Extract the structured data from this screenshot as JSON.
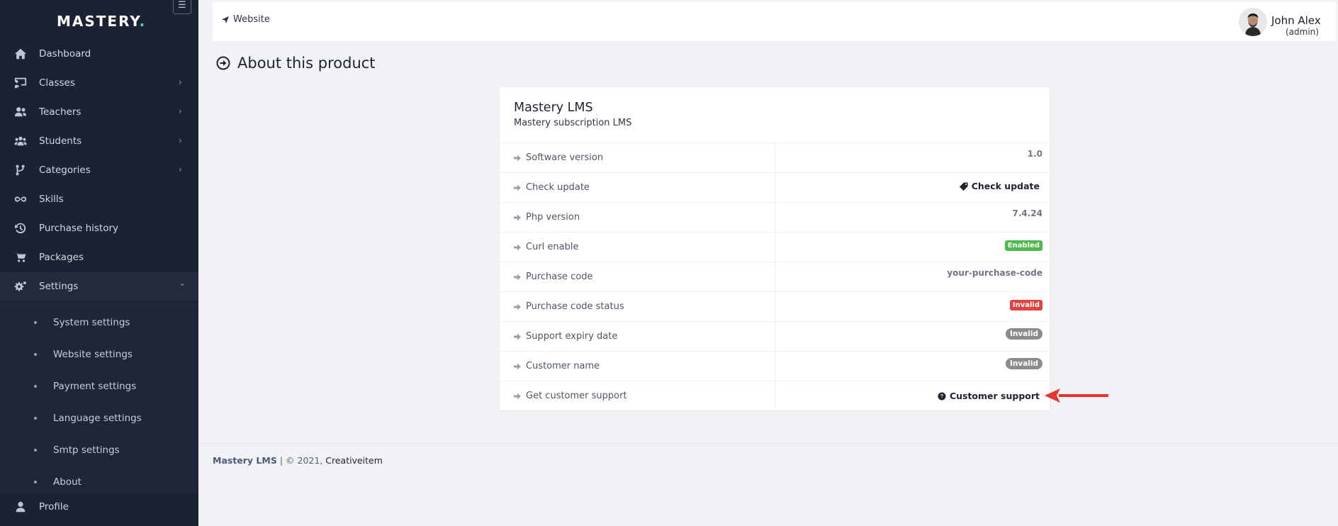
{
  "brand": {
    "name": "MASTERY",
    "dot": "."
  },
  "sidebar": {
    "items": [
      {
        "label": "Dashboard",
        "icon": "home-icon"
      },
      {
        "label": "Classes",
        "icon": "chalkboard-icon",
        "chevron": "›"
      },
      {
        "label": "Teachers",
        "icon": "users-icon",
        "chevron": "›"
      },
      {
        "label": "Students",
        "icon": "user-group-icon",
        "chevron": "›"
      },
      {
        "label": "Categories",
        "icon": "code-branch-icon",
        "chevron": "›"
      },
      {
        "label": "Skills",
        "icon": "infinity-icon"
      },
      {
        "label": "Purchase history",
        "icon": "history-icon"
      },
      {
        "label": "Packages",
        "icon": "cart-icon"
      },
      {
        "label": "Settings",
        "icon": "cogs-icon",
        "chevron": "⌄"
      }
    ],
    "settings_submenu": [
      {
        "label": "System settings"
      },
      {
        "label": "Website settings"
      },
      {
        "label": "Payment settings"
      },
      {
        "label": "Language settings"
      },
      {
        "label": "Smtp settings"
      },
      {
        "label": "About"
      }
    ],
    "profile": {
      "label": "Profile",
      "icon": "user-icon"
    }
  },
  "header": {
    "breadcrumb": "Website",
    "user_name": "John Alex",
    "user_role": "(admin)"
  },
  "page": {
    "title": "About this product"
  },
  "card": {
    "title": "Mastery LMS",
    "subtitle": "Mastery subscription LMS",
    "rows": [
      {
        "label": "Software version",
        "value": "1.0"
      },
      {
        "label": "Check update",
        "value": "Check update"
      },
      {
        "label": "Php version",
        "value": "7.4.24"
      },
      {
        "label": "Curl enable",
        "value": "Enabled"
      },
      {
        "label": "Purchase code",
        "value": "your-purchase-code"
      },
      {
        "label": "Purchase code status",
        "value": "Invalid"
      },
      {
        "label": "Support expiry date",
        "value": "Invalid"
      },
      {
        "label": "Customer name",
        "value": "Invalid"
      },
      {
        "label": "Get customer support",
        "value": "Customer support"
      }
    ]
  },
  "footer": {
    "brand": "Mastery LMS",
    "copyright": "| © 2021,",
    "company": "Creativeitem"
  },
  "colors": {
    "sidebar_bg": "#1b2234",
    "accent_dot": "#4cd5a0",
    "success": "#4fb950",
    "danger": "#e54040",
    "muted_badge": "#8b8b8b",
    "annotation_arrow": "#e8322a"
  }
}
